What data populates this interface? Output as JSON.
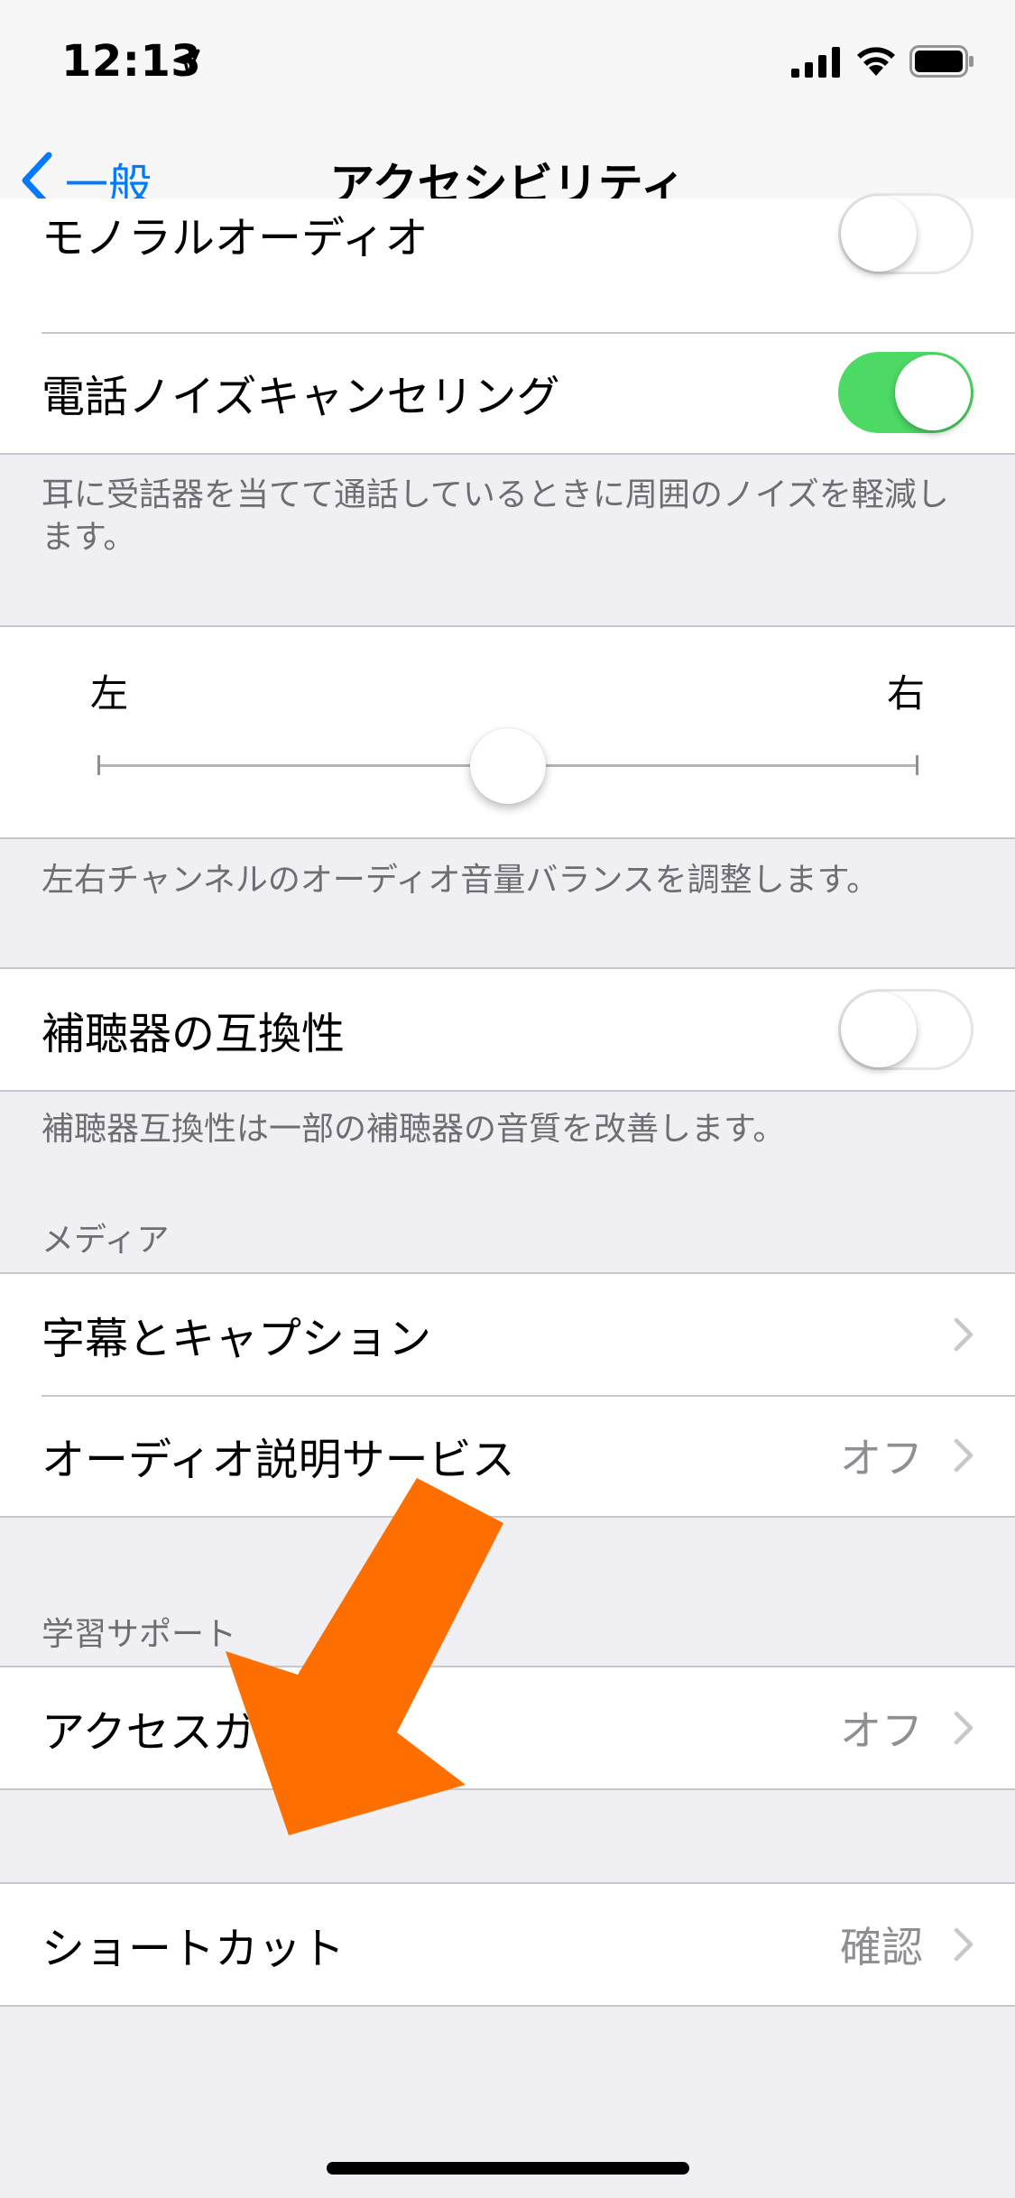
{
  "status": {
    "time": "12:13"
  },
  "nav": {
    "back_label": "一般",
    "title": "アクセシビリティ"
  },
  "audio": {
    "mono_label": "モノラルオーディオ",
    "mono_on": false,
    "noise_label": "電話ノイズキャンセリング",
    "noise_on": true,
    "noise_footer": "耳に受話器を当てて通話しているときに周囲のノイズを軽減します。"
  },
  "balance": {
    "left_label": "左",
    "right_label": "右",
    "value": 0.5,
    "footer": "左右チャンネルのオーディオ音量バランスを調整します。"
  },
  "hearing_aid": {
    "label": "補聴器の互換性",
    "on": false,
    "footer": "補聴器互換性は一部の補聴器の音質を改善します。"
  },
  "media": {
    "header": "メディア",
    "items": [
      {
        "label": "字幕とキャプション",
        "value": ""
      },
      {
        "label": "オーディオ説明サービス",
        "value": "オフ"
      }
    ]
  },
  "learning": {
    "header": "学習サポート",
    "items": [
      {
        "label": "アクセスガイド",
        "value": "オフ"
      }
    ]
  },
  "shortcut": {
    "label": "ショートカット",
    "value": "確認"
  },
  "colors": {
    "accent": "#007aff",
    "switch_on": "#4cd964",
    "annotation_arrow": "#ff6f00"
  }
}
